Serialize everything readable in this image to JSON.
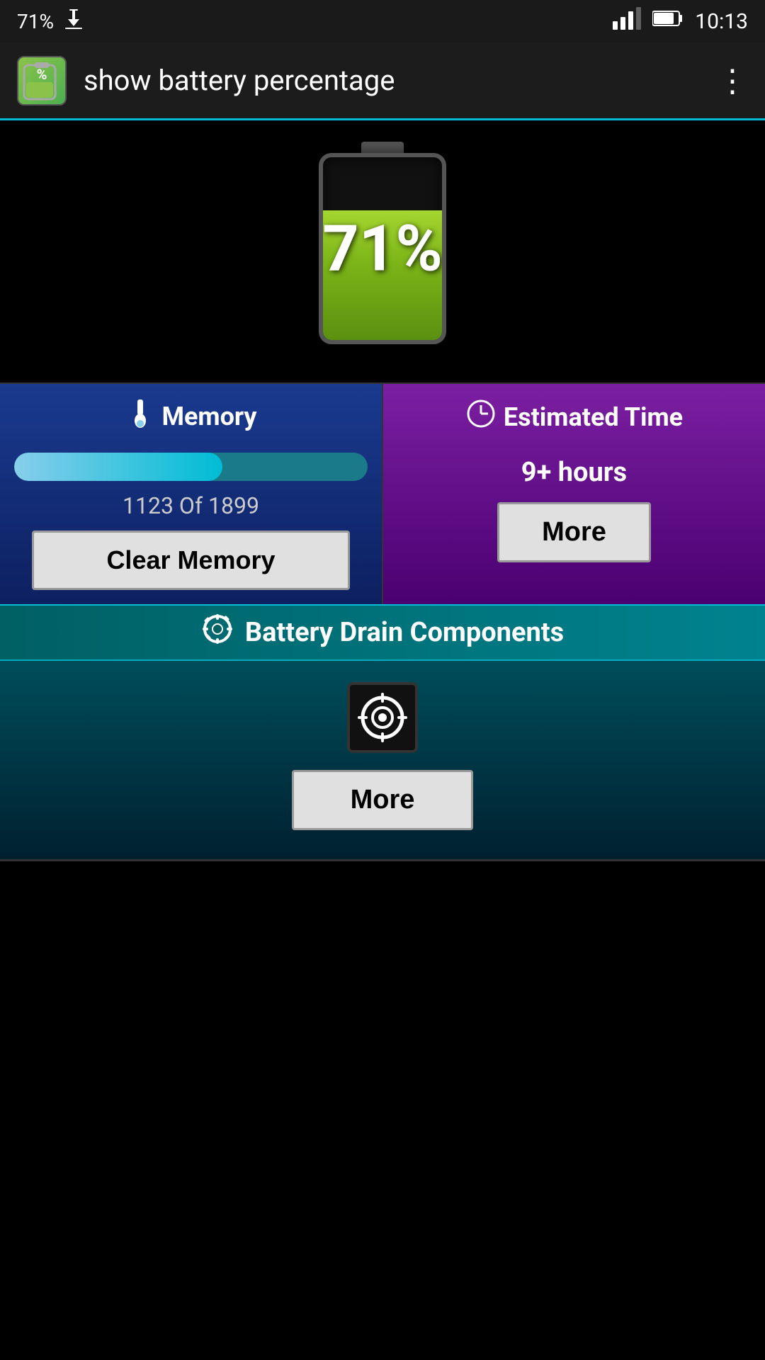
{
  "statusBar": {
    "batteryPercent": "71%",
    "time": "10:13",
    "signalBars": "signal",
    "batteryIcon": "battery"
  },
  "appBar": {
    "title": "show battery percentage",
    "iconLabel": "%",
    "overflowMenu": "⋮"
  },
  "batteryDisplay": {
    "percentage": "71%",
    "fillPercent": 71
  },
  "memoryPanel": {
    "header": "Memory",
    "ratio": "1123 Of 1899",
    "fillPercent": 59,
    "clearButton": "Clear Memory"
  },
  "estimatedPanel": {
    "header": "Estimated Time",
    "time": "9+ hours",
    "moreButton": "More"
  },
  "drainSection": {
    "header": "Battery Drain Components",
    "moreButton": "More"
  }
}
